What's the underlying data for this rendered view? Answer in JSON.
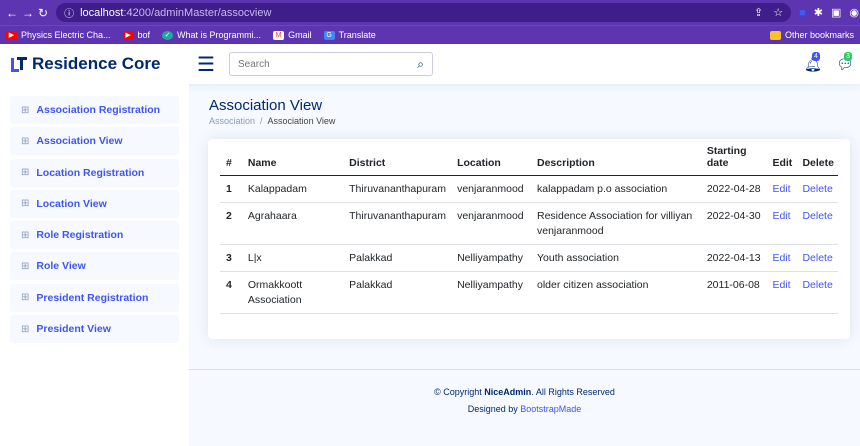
{
  "browser": {
    "url_host": "localhost",
    "url_path": ":4200/adminMaster/assocview",
    "bookmarks": [
      {
        "label": "Physics Electric Cha...",
        "icon": "youtube-icon",
        "color": "#ff0000"
      },
      {
        "label": "bof",
        "icon": "youtube-icon",
        "color": "#ff0000"
      },
      {
        "label": "What is Programmi...",
        "icon": "shield-icon",
        "color": "#26a69a"
      },
      {
        "label": "Gmail",
        "icon": "gmail-icon",
        "color": "#ea4335"
      },
      {
        "label": "Translate",
        "icon": "translate-icon",
        "color": "#4285f4"
      }
    ],
    "other_bookmarks": "Other bookmarks"
  },
  "header": {
    "brand": "Residence Core",
    "search_placeholder": "Search",
    "notifications_count": "4",
    "messages_count": "3"
  },
  "sidebar": {
    "items": [
      {
        "label": "Association Registration"
      },
      {
        "label": "Association View"
      },
      {
        "label": "Location Registration"
      },
      {
        "label": "Location View"
      },
      {
        "label": "Role Registration"
      },
      {
        "label": "Role View"
      },
      {
        "label": "President Registration"
      },
      {
        "label": "President View"
      }
    ]
  },
  "page": {
    "title": "Association View",
    "breadcrumb_parent": "Association",
    "breadcrumb_current": "Association View"
  },
  "table": {
    "headers": {
      "num": "#",
      "name": "Name",
      "district": "District",
      "location": "Location",
      "description": "Description",
      "start1": "Starting",
      "start2": "date",
      "edit": "Edit",
      "delete": "Delete"
    },
    "rows": [
      {
        "num": "1",
        "name": "Kalappadam",
        "district": "Thiruvananthapuram",
        "location": "venjaranmood",
        "description": "kalappadam p.o association",
        "date": "2022-04-28",
        "edit": "Edit",
        "delete": "Delete"
      },
      {
        "num": "2",
        "name": "Agrahaara",
        "district": "Thiruvananthapuram",
        "location": "venjaranmood",
        "description": "Residence Association for villiyan venjaranmood",
        "date": "2022-04-30",
        "edit": "Edit",
        "delete": "Delete"
      },
      {
        "num": "3",
        "name": "L|x",
        "district": "Palakkad",
        "location": "Nelliyampathy",
        "description": "Youth association",
        "date": "2022-04-13",
        "edit": "Edit",
        "delete": "Delete"
      },
      {
        "num": "4",
        "name": "Ormakkoott Association",
        "district": "Palakkad",
        "location": "Nelliyampathy",
        "description": "older citizen association",
        "date": "2011-06-08",
        "edit": "Edit",
        "delete": "Delete"
      }
    ]
  },
  "footer": {
    "copyright_prefix": "© Copyright ",
    "brand": "NiceAdmin",
    "copyright_suffix": ". All Rights Reserved",
    "designed_by": "Designed by ",
    "designer": "BootstrapMade"
  }
}
